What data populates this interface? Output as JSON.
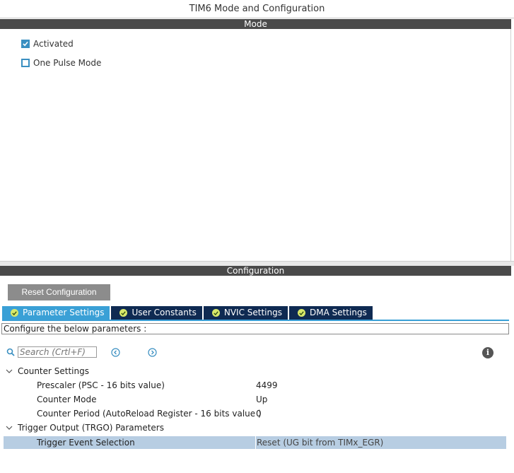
{
  "window": {
    "title": "TIM6 Mode and Configuration"
  },
  "mode": {
    "header": "Mode",
    "options": [
      {
        "label": "Activated",
        "checked": true
      },
      {
        "label": "One Pulse Mode",
        "checked": false
      }
    ]
  },
  "configuration": {
    "header": "Configuration",
    "reset_label": "Reset Configuration",
    "tabs": [
      {
        "label": "Parameter Settings",
        "active": true
      },
      {
        "label": "User Constants",
        "active": false
      },
      {
        "label": "NVIC Settings",
        "active": false
      },
      {
        "label": "DMA Settings",
        "active": false
      }
    ],
    "description": "Configure the below parameters :",
    "search": {
      "placeholder": "Search (Crtl+F)"
    },
    "groups": [
      {
        "label": "Counter Settings",
        "params": [
          {
            "name": "Prescaler (PSC - 16 bits value)",
            "value": "4499"
          },
          {
            "name": "Counter Mode",
            "value": "Up"
          },
          {
            "name": "Counter Period (AutoReload Register - 16 bits value )",
            "value": "0"
          }
        ]
      },
      {
        "label": "Trigger Output (TRGO) Parameters",
        "params": [
          {
            "name": "Trigger Event Selection",
            "value": "Reset (UG bit from TIMx_EGR)"
          }
        ]
      }
    ]
  },
  "colors": {
    "accent": "#3aa0d6",
    "tab_dark": "#0f2a52",
    "header_bar": "#4a4a4a",
    "selected_row": "#b7cde2"
  }
}
